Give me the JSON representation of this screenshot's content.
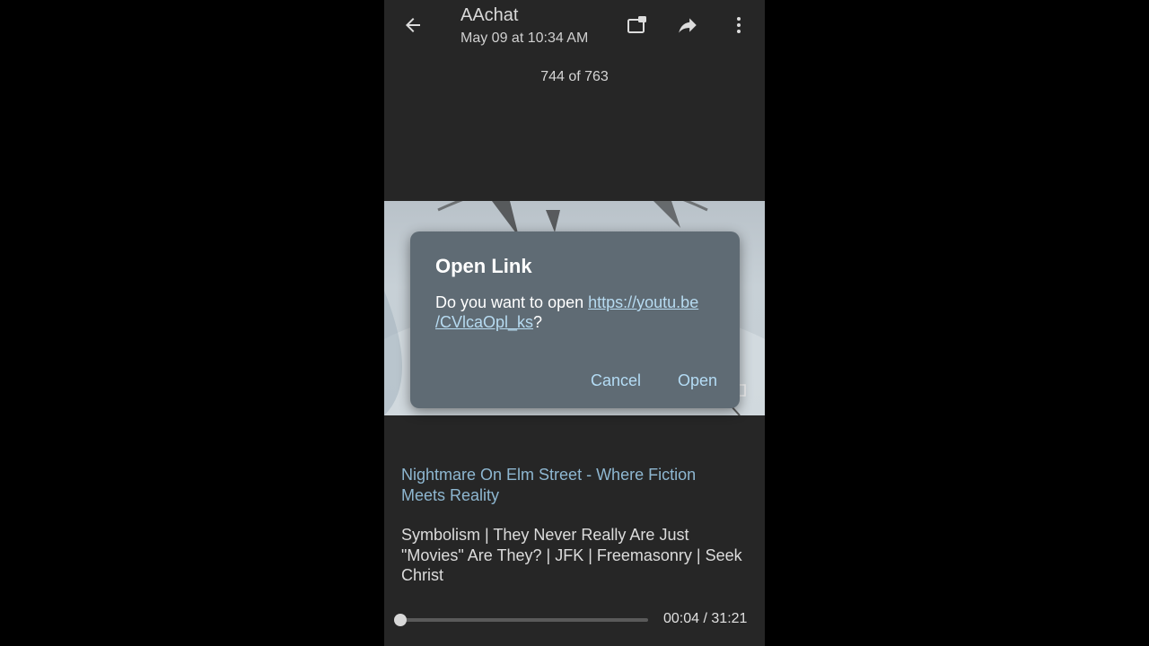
{
  "header": {
    "title": "AAchat",
    "subtitle": "May 09 at 10:34 AM",
    "counter": "744 of 763",
    "icons": [
      "back-arrow-icon",
      "share-to-app-icon",
      "forward-icon",
      "more-vert-icon"
    ]
  },
  "dialog": {
    "title": "Open Link",
    "prompt": "Do you want to open ",
    "link_line1": "https://youtu.be",
    "link_line2": "/CVlcaOpl_ks",
    "suffix": "?",
    "cancel_label": "Cancel",
    "open_label": "Open"
  },
  "caption": {
    "title": "Nightmare On Elm Street - Where Fiction Meets Reality",
    "text": "Symbolism | They Never Really Are Just \"Movies\" Are They? | JFK | Freemasonry | Seek Christ"
  },
  "player": {
    "current": "00:04",
    "separator": " / ",
    "duration": "31:21",
    "progress": 0.002
  },
  "colors": {
    "background": "#262626",
    "dialog": "#5f6b74",
    "accent": "#b4dcf5",
    "caption_title": "#8eb7d1"
  }
}
